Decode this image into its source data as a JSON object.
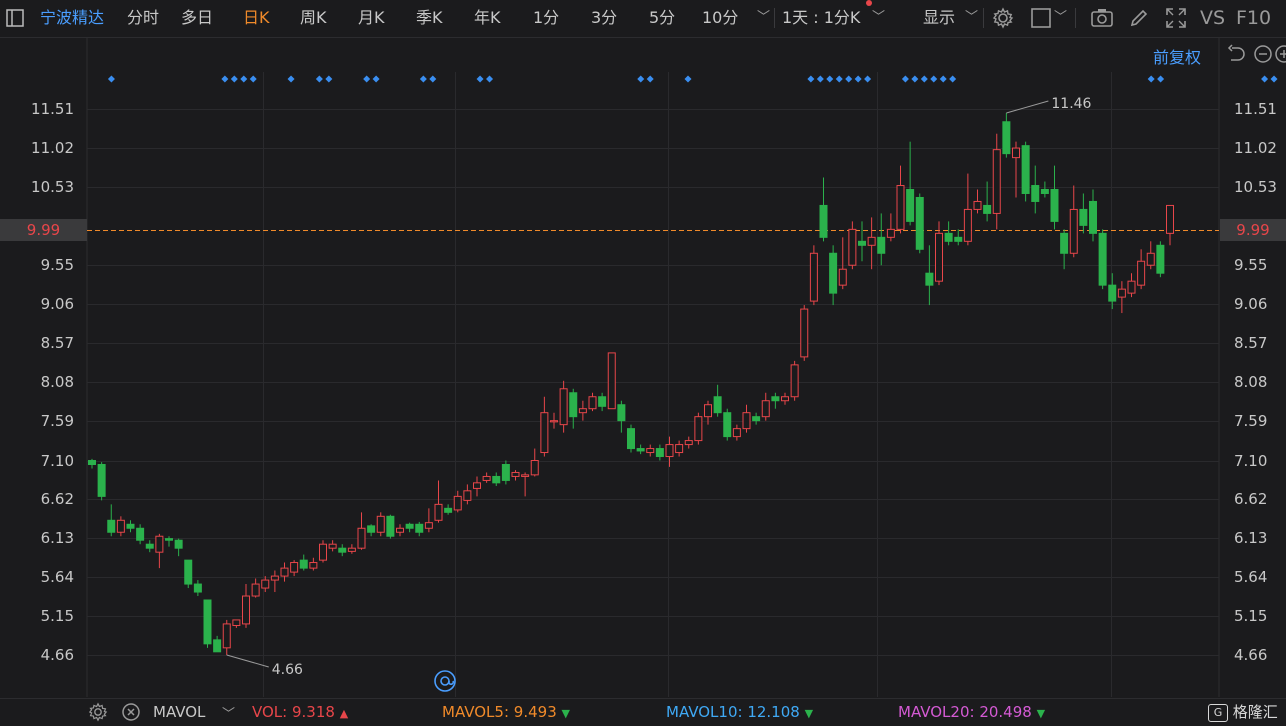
{
  "toolbar": {
    "stock_name": "宁波精达",
    "tabs": [
      "分时",
      "多日",
      "日K",
      "周K",
      "月K",
      "季K",
      "年K",
      "1分",
      "3分",
      "5分",
      "10分"
    ],
    "active_tab": "日K",
    "period_select": "1天 : 1分K",
    "display_label": "显示",
    "vs_label": "VS",
    "f10_label": "F10"
  },
  "subbar": {
    "adjust_label": "前复权"
  },
  "chart_data": {
    "type": "candlestick",
    "y_ticks": [
      "11.51",
      "11.02",
      "10.53",
      "9.99",
      "9.55",
      "9.06",
      "8.57",
      "8.08",
      "7.59",
      "7.10",
      "6.62",
      "6.13",
      "5.64",
      "5.15",
      "4.66"
    ],
    "y_range": [
      4.66,
      11.51
    ],
    "current_price": "9.99",
    "high_label": "11.46",
    "low_label": "4.66",
    "up_color": "#e8464a",
    "down_color": "#2bb24c",
    "candles": [
      [
        7.1,
        7.05,
        7.12,
        7.0
      ],
      [
        7.05,
        6.65,
        7.08,
        6.6
      ],
      [
        6.35,
        6.2,
        6.55,
        6.15
      ],
      [
        6.2,
        6.35,
        6.4,
        6.15
      ],
      [
        6.3,
        6.25,
        6.35,
        6.2
      ],
      [
        6.25,
        6.1,
        6.3,
        6.05
      ],
      [
        6.05,
        6.0,
        6.1,
        5.95
      ],
      [
        5.95,
        6.15,
        6.18,
        5.75
      ],
      [
        6.12,
        6.1,
        6.15,
        6.02
      ],
      [
        6.1,
        6.0,
        6.12,
        5.9
      ],
      [
        5.85,
        5.55,
        5.85,
        5.5
      ],
      [
        5.55,
        5.45,
        5.6,
        5.4
      ],
      [
        5.35,
        4.8,
        5.35,
        4.75
      ],
      [
        4.85,
        4.7,
        4.9,
        4.7
      ],
      [
        4.75,
        5.05,
        5.1,
        4.66
      ],
      [
        5.03,
        5.1,
        5.1,
        5.0
      ],
      [
        5.05,
        5.4,
        5.55,
        5.0
      ],
      [
        5.4,
        5.55,
        5.62,
        5.38
      ],
      [
        5.5,
        5.6,
        5.65,
        5.45
      ],
      [
        5.6,
        5.65,
        5.72,
        5.45
      ],
      [
        5.65,
        5.75,
        5.82,
        5.58
      ],
      [
        5.7,
        5.82,
        5.85,
        5.65
      ],
      [
        5.85,
        5.75,
        5.92,
        5.72
      ],
      [
        5.75,
        5.82,
        5.88,
        5.72
      ],
      [
        5.85,
        6.05,
        6.1,
        5.82
      ],
      [
        6.0,
        6.05,
        6.1,
        5.96
      ],
      [
        6.0,
        5.95,
        6.05,
        5.9
      ],
      [
        5.96,
        6.0,
        6.05,
        5.93
      ],
      [
        6.0,
        6.25,
        6.45,
        5.98
      ],
      [
        6.28,
        6.2,
        6.3,
        6.15
      ],
      [
        6.2,
        6.4,
        6.45,
        6.15
      ],
      [
        6.4,
        6.15,
        6.42,
        6.12
      ],
      [
        6.2,
        6.25,
        6.3,
        6.15
      ],
      [
        6.3,
        6.25,
        6.32,
        6.2
      ],
      [
        6.3,
        6.2,
        6.33,
        6.15
      ],
      [
        6.25,
        6.32,
        6.5,
        6.2
      ],
      [
        6.35,
        6.55,
        6.85,
        6.32
      ],
      [
        6.5,
        6.45,
        6.55,
        6.42
      ],
      [
        6.48,
        6.65,
        6.72,
        6.45
      ],
      [
        6.6,
        6.72,
        6.8,
        6.55
      ],
      [
        6.75,
        6.82,
        6.9,
        6.65
      ],
      [
        6.85,
        6.9,
        6.95,
        6.82
      ],
      [
        6.9,
        6.82,
        6.95,
        6.78
      ],
      [
        7.05,
        6.85,
        7.1,
        6.8
      ],
      [
        6.9,
        6.95,
        6.98,
        6.85
      ],
      [
        6.9,
        6.92,
        6.95,
        6.65
      ],
      [
        6.92,
        7.1,
        7.25,
        6.9
      ],
      [
        7.2,
        7.7,
        7.9,
        7.15
      ],
      [
        7.6,
        7.6,
        7.7,
        7.5
      ],
      [
        7.55,
        8.0,
        8.1,
        7.45
      ],
      [
        7.95,
        7.65,
        8.0,
        7.5
      ],
      [
        7.7,
        7.75,
        7.85,
        7.6
      ],
      [
        7.75,
        7.9,
        7.95,
        7.72
      ],
      [
        7.9,
        7.78,
        7.95,
        7.72
      ],
      [
        7.75,
        8.45,
        8.45,
        7.75
      ],
      [
        7.8,
        7.6,
        7.85,
        7.45
      ],
      [
        7.5,
        7.25,
        7.55,
        7.2
      ],
      [
        7.25,
        7.22,
        7.3,
        7.18
      ],
      [
        7.2,
        7.25,
        7.3,
        7.15
      ],
      [
        7.25,
        7.15,
        7.3,
        7.1
      ],
      [
        7.15,
        7.3,
        7.4,
        7.02
      ],
      [
        7.2,
        7.3,
        7.35,
        7.15
      ],
      [
        7.3,
        7.35,
        7.4,
        7.25
      ],
      [
        7.35,
        7.65,
        7.7,
        7.3
      ],
      [
        7.65,
        7.8,
        7.85,
        7.55
      ],
      [
        7.9,
        7.7,
        8.05,
        7.65
      ],
      [
        7.7,
        7.4,
        7.75,
        7.35
      ],
      [
        7.4,
        7.5,
        7.55,
        7.35
      ],
      [
        7.5,
        7.7,
        7.8,
        7.45
      ],
      [
        7.65,
        7.6,
        7.7,
        7.55
      ],
      [
        7.65,
        7.85,
        7.95,
        7.6
      ],
      [
        7.9,
        7.85,
        7.95,
        7.75
      ],
      [
        7.85,
        7.9,
        7.95,
        7.8
      ],
      [
        7.9,
        8.3,
        8.35,
        7.85
      ],
      [
        8.4,
        9.0,
        9.05,
        8.35
      ],
      [
        9.1,
        9.7,
        9.8,
        9.05
      ],
      [
        10.3,
        9.9,
        10.65,
        9.85
      ],
      [
        9.7,
        9.2,
        9.8,
        9.05
      ],
      [
        9.3,
        9.5,
        9.9,
        9.25
      ],
      [
        9.55,
        10.0,
        10.1,
        9.5
      ],
      [
        9.85,
        9.8,
        10.1,
        9.6
      ],
      [
        9.8,
        9.9,
        10.15,
        9.5
      ],
      [
        9.9,
        9.7,
        10.2,
        9.55
      ],
      [
        9.9,
        10.0,
        10.2,
        9.85
      ],
      [
        10.0,
        10.55,
        10.8,
        9.95
      ],
      [
        10.5,
        10.1,
        11.1,
        10.05
      ],
      [
        10.4,
        9.75,
        10.45,
        9.7
      ],
      [
        9.45,
        9.3,
        9.8,
        9.05
      ],
      [
        9.35,
        9.95,
        10.1,
        9.3
      ],
      [
        9.95,
        9.85,
        10.1,
        9.8
      ],
      [
        9.9,
        9.85,
        10.0,
        9.8
      ],
      [
        9.85,
        10.25,
        10.7,
        9.8
      ],
      [
        10.25,
        10.35,
        10.5,
        10.2
      ],
      [
        10.3,
        10.2,
        10.6,
        10.1
      ],
      [
        10.2,
        11.0,
        11.2,
        10.0
      ],
      [
        11.35,
        10.95,
        11.46,
        10.9
      ],
      [
        10.9,
        11.02,
        11.1,
        10.4
      ],
      [
        11.05,
        10.45,
        11.1,
        10.35
      ],
      [
        10.55,
        10.35,
        10.8,
        10.2
      ],
      [
        10.5,
        10.45,
        10.6,
        10.4
      ],
      [
        10.5,
        10.1,
        10.8,
        10.0
      ],
      [
        9.95,
        9.7,
        10.0,
        9.5
      ],
      [
        9.7,
        10.25,
        10.55,
        9.65
      ],
      [
        10.25,
        10.05,
        10.45,
        9.95
      ],
      [
        10.35,
        9.95,
        10.5,
        9.85
      ],
      [
        9.95,
        9.3,
        10.0,
        9.25
      ],
      [
        9.3,
        9.1,
        9.45,
        9.0
      ],
      [
        9.15,
        9.25,
        9.35,
        8.95
      ],
      [
        9.2,
        9.35,
        9.45,
        9.15
      ],
      [
        9.3,
        9.6,
        9.75,
        9.25
      ],
      [
        9.55,
        9.7,
        9.85,
        9.5
      ],
      [
        9.8,
        9.45,
        9.85,
        9.4
      ],
      [
        9.95,
        10.3,
        10.3,
        9.8
      ]
    ],
    "marker_groups": [
      [
        1
      ],
      [
        13,
        14,
        15,
        16
      ],
      [
        20
      ],
      [
        23,
        24
      ],
      [
        28,
        29
      ],
      [
        34,
        35
      ],
      [
        40,
        41
      ],
      [
        57,
        58
      ],
      [
        62
      ],
      [
        75,
        76,
        77,
        78,
        79,
        80,
        81
      ],
      [
        85,
        86,
        87,
        88,
        89,
        90
      ],
      [
        111,
        112
      ],
      [
        123,
        124
      ]
    ]
  },
  "bottom": {
    "indicator": "MAVOL",
    "vol_label": "VOL:",
    "vol_value": "9.318",
    "mavol5_label": "MAVOL5:",
    "mavol5_value": "9.493",
    "mavol10_label": "MAVOL10:",
    "mavol10_value": "12.108",
    "mavol20_label": "MAVOL20:",
    "mavol20_value": "20.498",
    "vol_color": "#e8464a",
    "mavol5_color": "#f08a2a",
    "mavol10_color": "#3fa9f5",
    "mavol20_color": "#d45ad4",
    "brand": "格隆汇"
  }
}
